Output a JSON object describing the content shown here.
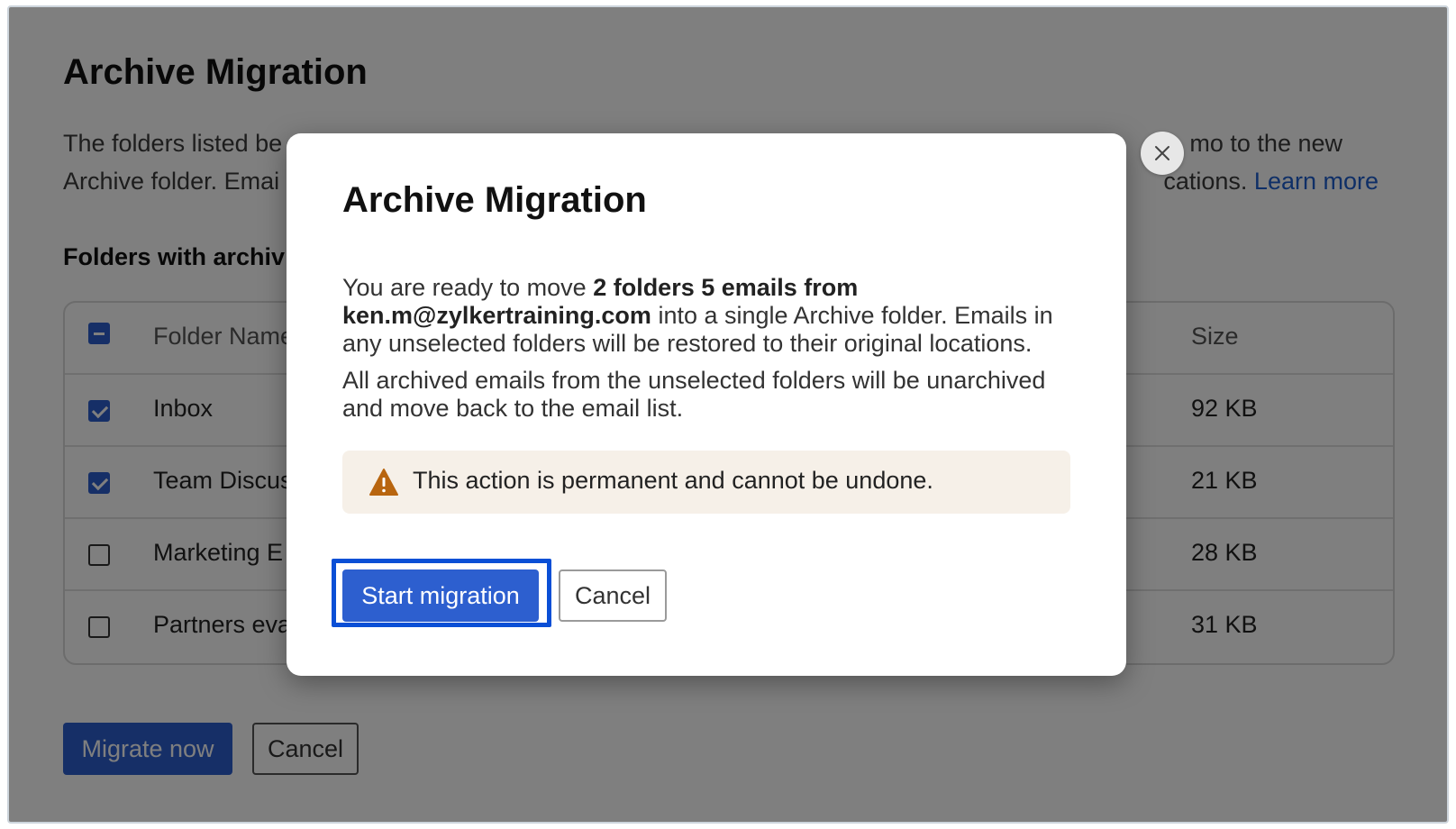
{
  "page": {
    "title": "Archive Migration",
    "description_line1_left": "The folders listed be",
    "description_line1_right": "mo to the new",
    "description_line2_left": "Archive folder. Emai",
    "description_line2_right": "cations.",
    "learn_more": "Learn more",
    "section_title": "Folders with archiv",
    "table": {
      "header": {
        "name": "Folder Name",
        "size": "Size"
      },
      "rows": [
        {
          "name": "Inbox",
          "size": "92 KB",
          "checked": true
        },
        {
          "name": "Team Discus",
          "size": "21 KB",
          "checked": true
        },
        {
          "name": "Marketing E",
          "size": "28 KB",
          "checked": false
        },
        {
          "name": "Partners eva",
          "size": "31 KB",
          "checked": false
        }
      ]
    },
    "migrate_label": "Migrate now",
    "cancel_label": "Cancel"
  },
  "modal": {
    "title": "Archive Migration",
    "body_intro": "You are ready to move ",
    "body_bold_count": "2 folders 5 emails from",
    "body_bold_email": "ken.m@zylkertraining.com",
    "body_rest": " into a single Archive folder. Emails in any unselected folders will be restored to their original locations.",
    "body_second": "All archived emails from the unselected folders will be unarchived and move back to the email list.",
    "warning": "This action is permanent and cannot be undone.",
    "start_label": "Start migration",
    "cancel_label": "Cancel"
  },
  "icons": {
    "close": "close-icon",
    "warning": "warning-icon",
    "checkbox_checked": "checkbox-checked-icon",
    "checkbox_indeterminate": "checkbox-indeterminate-icon"
  },
  "colors": {
    "primary": "#2d5fcf",
    "focus": "#0a4fd6",
    "warning_bg": "#f6f0e8",
    "warning_icon": "#b8650f",
    "link": "#1f5fcf"
  }
}
